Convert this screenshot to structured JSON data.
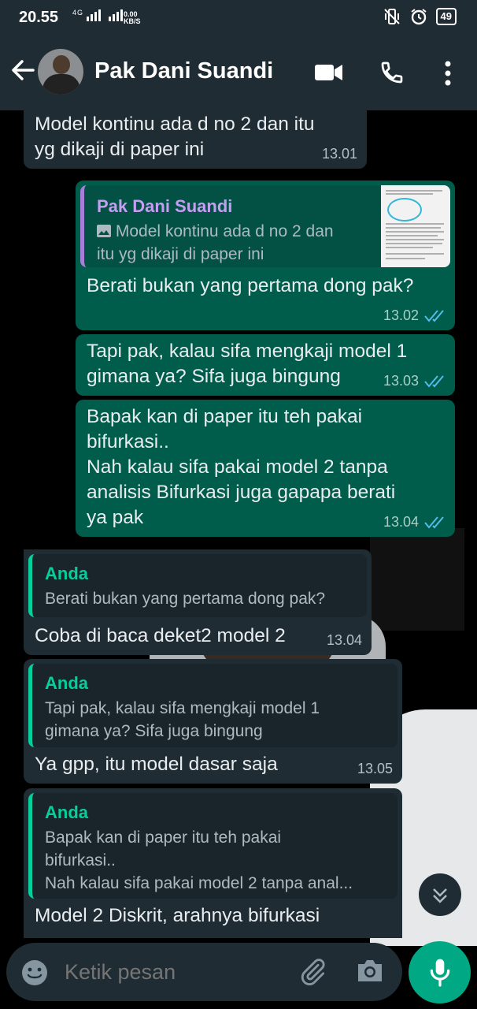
{
  "status": {
    "time": "20.55",
    "network": "4G",
    "speed_value": "0.00",
    "speed_unit": "KB/S",
    "battery": "49"
  },
  "header": {
    "contact_name": "Pak Dani Suandi"
  },
  "messages": [
    {
      "text_l1": "Model kontinu ada d no 2 dan itu",
      "text_l2": "yg dikaji di paper ini",
      "time": "13.01"
    },
    {
      "quote_name": "Pak Dani Suandi",
      "quote_l1": "Model kontinu ada d no 2 dan",
      "quote_l2": "itu yg dikaji di paper ini",
      "text_l1": "Berati bukan yang pertama dong pak?",
      "time": "13.02"
    },
    {
      "text_l1": "Tapi pak, kalau sifa mengkaji model 1",
      "text_l2": "gimana ya? Sifa juga bingung",
      "time": "13.03"
    },
    {
      "text_l1": "Bapak kan di paper itu teh pakai",
      "text_l2": "bifurkasi..",
      "text_l3": "Nah kalau sifa pakai model 2 tanpa",
      "text_l4": "analisis Bifurkasi juga gapapa berati",
      "text_l5": "ya pak",
      "time": "13.04"
    },
    {
      "quote_name": "Anda",
      "quote_l1": "Berati bukan yang pertama dong pak?",
      "text_l1": "Coba di baca deket2 model 2",
      "time": "13.04"
    },
    {
      "quote_name": "Anda",
      "quote_l1": "Tapi pak, kalau sifa mengkaji model 1",
      "quote_l2": "gimana ya? Sifa juga bingung",
      "text_l1": "Ya gpp, itu model dasar saja",
      "time": "13.05"
    },
    {
      "quote_name": "Anda",
      "quote_l1": "Bapak kan di paper itu teh pakai",
      "quote_l2": "bifurkasi..",
      "quote_l3": "Nah kalau sifa pakai model 2 tanpa anal...",
      "text_l1": "Model 2 Diskrit, arahnya bifurkasi"
    }
  ],
  "input": {
    "placeholder": "Ketik pesan"
  },
  "colors": {
    "header": "#1f2c33",
    "outgoing": "#005c4b",
    "incoming": "#1f2c33",
    "accent": "#00a884",
    "read_tick": "#53bdeb"
  }
}
